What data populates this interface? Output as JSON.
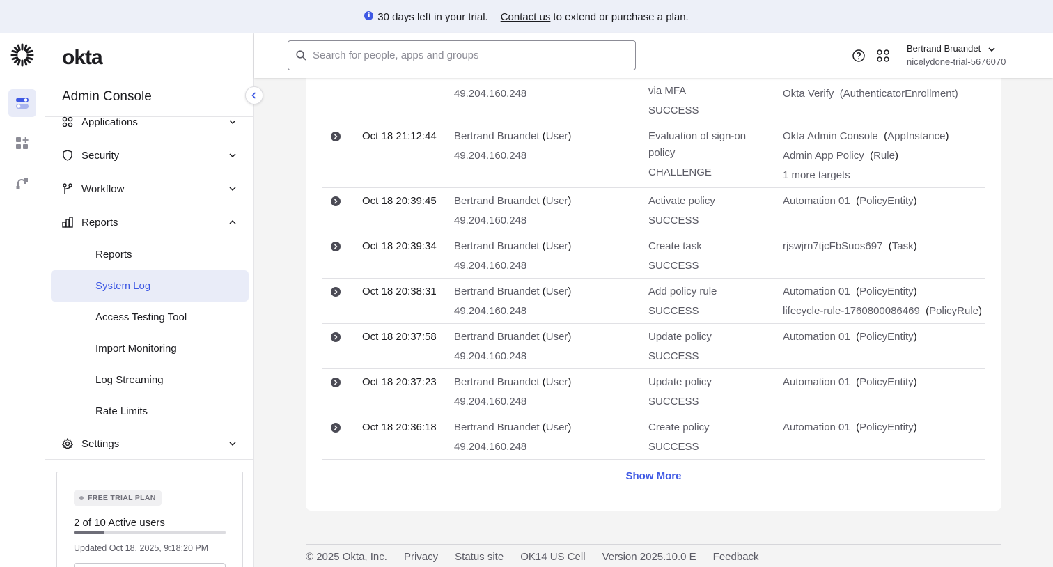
{
  "banner": {
    "text": "30 days left in your trial.",
    "link": "Contact us",
    "suffix": "to extend or purchase a plan."
  },
  "sidebar": {
    "brand": "okta",
    "console_title": "Admin Console",
    "items": [
      {
        "label": "Applications",
        "icon": "grid-icon",
        "expanded": false
      },
      {
        "label": "Security",
        "icon": "shield-icon",
        "expanded": false
      },
      {
        "label": "Workflow",
        "icon": "workflow-icon",
        "expanded": false
      },
      {
        "label": "Reports",
        "icon": "bar-chart-icon",
        "expanded": true
      },
      {
        "label": "Settings",
        "icon": "gear-icon",
        "expanded": false
      }
    ],
    "reports_sub": [
      "Reports",
      "System Log",
      "Access Testing Tool",
      "Import Monitoring",
      "Log Streaming",
      "Rate Limits"
    ],
    "active_sub": "System Log"
  },
  "trial_card": {
    "badge": "FREE TRIAL PLAN",
    "active_users": "2 of 10 Active users",
    "active_fraction": 0.2,
    "updated": "Updated Oct 18, 2025, 9:18:20 PM"
  },
  "topbar": {
    "search_placeholder": "Search for people, apps and groups",
    "user_name": "Bertrand Bruandet",
    "user_org": "nicelydone-trial-5676070"
  },
  "log": {
    "partial_row": {
      "actor_ip": "49.204.160.248",
      "event_lines": [
        "via MFA",
        "SUCCESS"
      ],
      "target": "Okta Verify",
      "target_type": "(AuthenticatorEnrollment)"
    },
    "rows": [
      {
        "time": "Oct 18 21:12:44",
        "actor": "Bertrand Bruandet",
        "actor_type": "User",
        "ip": "49.204.160.248",
        "event": [
          "Evaluation of sign-on",
          "policy"
        ],
        "outcome": "CHALLENGE",
        "targets": [
          {
            "name": "Okta Admin Console",
            "type": "AppInstance"
          },
          {
            "name": "Admin App Policy",
            "type": "Rule"
          }
        ],
        "more": "1 more targets"
      },
      {
        "time": "Oct 18 20:39:45",
        "actor": "Bertrand Bruandet",
        "actor_type": "User",
        "ip": "49.204.160.248",
        "event": [
          "Activate policy"
        ],
        "outcome": "SUCCESS",
        "targets": [
          {
            "name": "Automation 01",
            "type": "PolicyEntity"
          }
        ]
      },
      {
        "time": "Oct 18 20:39:34",
        "actor": "Bertrand Bruandet",
        "actor_type": "User",
        "ip": "49.204.160.248",
        "event": [
          "Create task"
        ],
        "outcome": "SUCCESS",
        "targets": [
          {
            "name": "rjswjrn7tjcFbSuos697",
            "type": "Task"
          }
        ]
      },
      {
        "time": "Oct 18 20:38:31",
        "actor": "Bertrand Bruandet",
        "actor_type": "User",
        "ip": "49.204.160.248",
        "event": [
          "Add policy rule"
        ],
        "outcome": "SUCCESS",
        "targets": [
          {
            "name": "Automation 01",
            "type": "PolicyEntity"
          },
          {
            "name": "lifecycle-rule-1760800086469",
            "type": "PolicyRule"
          }
        ]
      },
      {
        "time": "Oct 18 20:37:58",
        "actor": "Bertrand Bruandet",
        "actor_type": "User",
        "ip": "49.204.160.248",
        "event": [
          "Update policy"
        ],
        "outcome": "SUCCESS",
        "targets": [
          {
            "name": "Automation 01",
            "type": "PolicyEntity"
          }
        ]
      },
      {
        "time": "Oct 18 20:37:23",
        "actor": "Bertrand Bruandet",
        "actor_type": "User",
        "ip": "49.204.160.248",
        "event": [
          "Update policy"
        ],
        "outcome": "SUCCESS",
        "targets": [
          {
            "name": "Automation 01",
            "type": "PolicyEntity"
          }
        ]
      },
      {
        "time": "Oct 18 20:36:18",
        "actor": "Bertrand Bruandet",
        "actor_type": "User",
        "ip": "49.204.160.248",
        "event": [
          "Create policy"
        ],
        "outcome": "SUCCESS",
        "targets": [
          {
            "name": "Automation 01",
            "type": "PolicyEntity"
          }
        ]
      }
    ],
    "show_more": "Show More"
  },
  "footer": [
    "© 2025 Okta, Inc.",
    "Privacy",
    "Status site",
    "OK14 US Cell",
    "Version 2025.10.0 E",
    "Feedback"
  ],
  "colors": {
    "accent": "#3f59e4",
    "banner_bg": "#edf0f8",
    "active_nav_bg": "#e9ecf8"
  }
}
